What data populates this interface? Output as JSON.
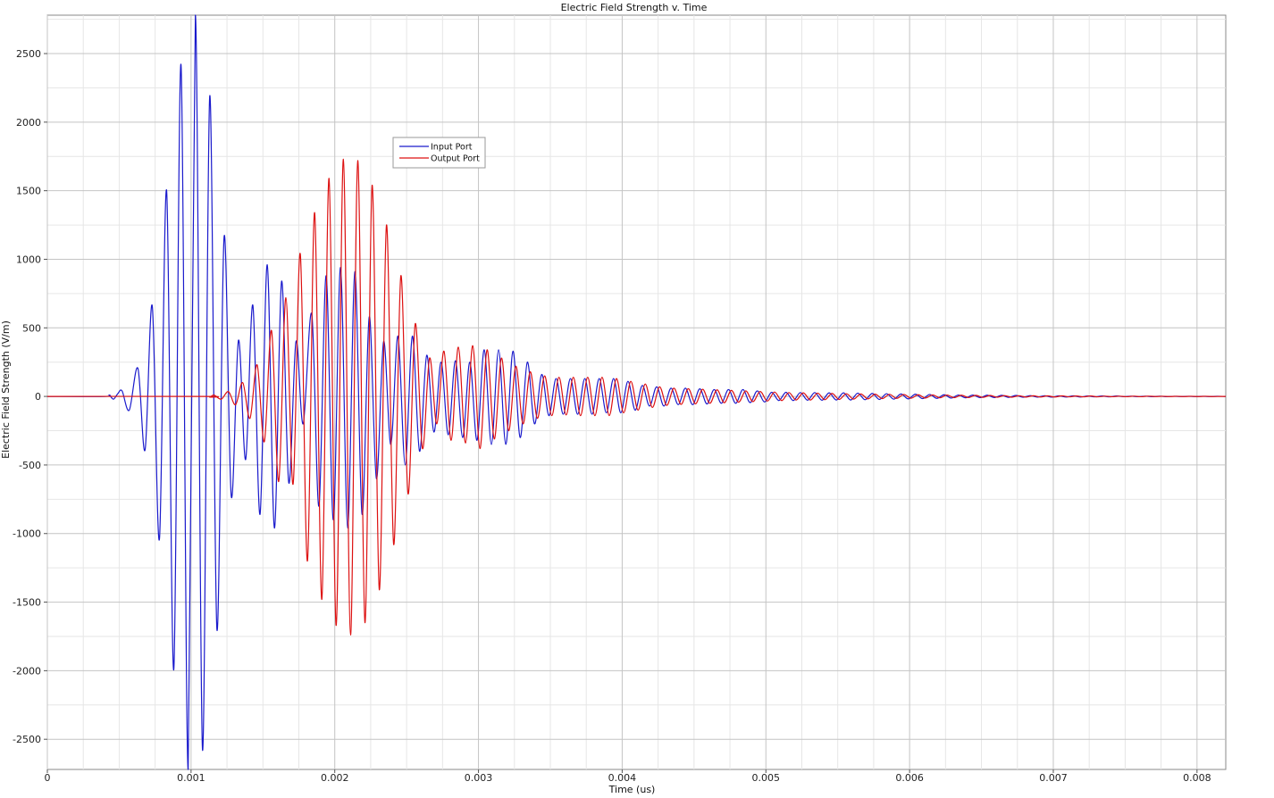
{
  "chart_data": {
    "type": "line",
    "title": "Electric Field Strength v. Time",
    "xlabel": "Time (us)",
    "ylabel": "Electric Field Strength (V/m)",
    "xlim": [
      0,
      0.0082
    ],
    "ylim": [
      -2720,
      2780
    ],
    "x_ticks": [
      "0",
      "0.001",
      "0.002",
      "0.003",
      "0.004",
      "0.005",
      "0.006",
      "0.007",
      "0.008"
    ],
    "y_ticks": [
      "-2500",
      "-2000",
      "-1500",
      "-1000",
      "-500",
      "0",
      "500",
      "1000",
      "1500",
      "2000",
      "2500"
    ],
    "grid": true,
    "legend_position": "upper-center",
    "series": [
      {
        "name": "Input Port",
        "color": "#1a1acc",
        "points": [
          [
            0.0004,
            0
          ],
          [
            0.00043,
            10
          ],
          [
            0.00046,
            -20
          ],
          [
            0.00049,
            20
          ],
          [
            0.00052,
            40
          ],
          [
            0.00057,
            -100
          ],
          [
            0.00063,
            205
          ],
          [
            0.00068,
            -390
          ],
          [
            0.00073,
            660
          ],
          [
            0.00078,
            -1040
          ],
          [
            0.00083,
            1500
          ],
          [
            0.00088,
            -1990
          ],
          [
            0.00093,
            2420
          ],
          [
            0.00098,
            -2720
          ],
          [
            0.00103,
            2780
          ],
          [
            0.00108,
            -2580
          ],
          [
            0.00113,
            2190
          ],
          [
            0.00118,
            -1700
          ],
          [
            0.00123,
            1165
          ],
          [
            0.00128,
            -730
          ],
          [
            0.00133,
            410
          ],
          [
            0.00138,
            -460
          ],
          [
            0.00143,
            665
          ],
          [
            0.00148,
            -860
          ],
          [
            0.00153,
            960
          ],
          [
            0.00158,
            -960
          ],
          [
            0.00163,
            840
          ],
          [
            0.00168,
            -630
          ],
          [
            0.00173,
            400
          ],
          [
            0.00178,
            -200
          ],
          [
            0.00184,
            600
          ],
          [
            0.00189,
            -800
          ],
          [
            0.00194,
            880
          ],
          [
            0.00199,
            -900
          ],
          [
            0.00204,
            940
          ],
          [
            0.00209,
            -960
          ],
          [
            0.00214,
            910
          ],
          [
            0.00219,
            -860
          ],
          [
            0.00224,
            580
          ],
          [
            0.00229,
            -600
          ],
          [
            0.00234,
            400
          ],
          [
            0.00239,
            -350
          ],
          [
            0.00244,
            440
          ],
          [
            0.00249,
            -500
          ],
          [
            0.00254,
            440
          ],
          [
            0.00259,
            -400
          ],
          [
            0.00264,
            300
          ],
          [
            0.00269,
            -260
          ],
          [
            0.00274,
            250
          ],
          [
            0.00279,
            -280
          ],
          [
            0.00284,
            260
          ],
          [
            0.00289,
            -300
          ],
          [
            0.00294,
            250
          ],
          [
            0.00299,
            -320
          ],
          [
            0.00304,
            340
          ],
          [
            0.00309,
            -350
          ],
          [
            0.00314,
            340
          ],
          [
            0.00319,
            -350
          ],
          [
            0.00324,
            330
          ],
          [
            0.00329,
            -300
          ],
          [
            0.00334,
            250
          ],
          [
            0.00339,
            -200
          ],
          [
            0.00344,
            160
          ],
          [
            0.00349,
            -140
          ],
          [
            0.00354,
            130
          ],
          [
            0.00359,
            -130
          ],
          [
            0.00364,
            130
          ],
          [
            0.00369,
            -130
          ],
          [
            0.00374,
            130
          ],
          [
            0.00379,
            -130
          ],
          [
            0.00384,
            130
          ],
          [
            0.00389,
            -120
          ],
          [
            0.00394,
            130
          ],
          [
            0.00399,
            -120
          ],
          [
            0.00404,
            110
          ],
          [
            0.00409,
            -100
          ],
          [
            0.00414,
            80
          ],
          [
            0.00419,
            -70
          ],
          [
            0.00424,
            70
          ],
          [
            0.00429,
            -70
          ],
          [
            0.00434,
            60
          ],
          [
            0.00439,
            -60
          ],
          [
            0.00444,
            60
          ],
          [
            0.00449,
            -60
          ],
          [
            0.00454,
            55
          ],
          [
            0.00459,
            -55
          ],
          [
            0.00464,
            50
          ],
          [
            0.00469,
            -50
          ],
          [
            0.00474,
            50
          ],
          [
            0.00479,
            -50
          ],
          [
            0.00484,
            50
          ],
          [
            0.00489,
            -45
          ],
          [
            0.00494,
            40
          ],
          [
            0.00499,
            -40
          ],
          [
            0.00504,
            30
          ],
          [
            0.00509,
            -30
          ],
          [
            0.00514,
            30
          ],
          [
            0.00519,
            -30
          ],
          [
            0.00524,
            28
          ],
          [
            0.00529,
            -28
          ],
          [
            0.00534,
            28
          ],
          [
            0.00539,
            -28
          ],
          [
            0.00544,
            26
          ],
          [
            0.00549,
            -26
          ],
          [
            0.00554,
            26
          ],
          [
            0.00559,
            -26
          ],
          [
            0.00564,
            24
          ],
          [
            0.00569,
            -24
          ],
          [
            0.00574,
            22
          ],
          [
            0.00579,
            -22
          ],
          [
            0.00584,
            20
          ],
          [
            0.00589,
            -20
          ],
          [
            0.00594,
            18
          ],
          [
            0.00599,
            -18
          ],
          [
            0.00604,
            16
          ],
          [
            0.00609,
            -16
          ],
          [
            0.00614,
            14
          ],
          [
            0.00619,
            -14
          ],
          [
            0.00624,
            12
          ],
          [
            0.00629,
            -12
          ],
          [
            0.00634,
            10
          ],
          [
            0.00639,
            -10
          ],
          [
            0.00644,
            10
          ],
          [
            0.00649,
            -9
          ],
          [
            0.00654,
            9
          ],
          [
            0.00659,
            -8
          ],
          [
            0.00664,
            8
          ],
          [
            0.00669,
            -7
          ],
          [
            0.00674,
            7
          ],
          [
            0.00679,
            -6
          ],
          [
            0.00684,
            6
          ],
          [
            0.00689,
            -5
          ],
          [
            0.00694,
            5
          ],
          [
            0.00699,
            -5
          ],
          [
            0.00704,
            4
          ],
          [
            0.00709,
            -4
          ],
          [
            0.00714,
            4
          ],
          [
            0.00719,
            -4
          ],
          [
            0.00724,
            3
          ],
          [
            0.00729,
            -3
          ],
          [
            0.00734,
            3
          ],
          [
            0.00739,
            -3
          ],
          [
            0.00744,
            3
          ],
          [
            0.00749,
            -2
          ],
          [
            0.00754,
            2
          ],
          [
            0.00759,
            -2
          ],
          [
            0.00764,
            2
          ],
          [
            0.00769,
            -2
          ],
          [
            0.00774,
            2
          ],
          [
            0.00779,
            -2
          ],
          [
            0.00784,
            1
          ],
          [
            0.00789,
            -1
          ],
          [
            0.00794,
            1
          ],
          [
            0.00799,
            -1
          ],
          [
            0.00804,
            1
          ],
          [
            0.00809,
            -1
          ],
          [
            0.00814,
            1
          ],
          [
            0.00819,
            0
          ]
        ]
      },
      {
        "name": "Output Port",
        "color": "#dd1111",
        "points": [
          [
            0.0,
            0
          ],
          [
            0.0011,
            0
          ],
          [
            0.00113,
            -5
          ],
          [
            0.00116,
            10
          ],
          [
            0.00121,
            -20
          ],
          [
            0.00126,
            35
          ],
          [
            0.00131,
            -60
          ],
          [
            0.00136,
            100
          ],
          [
            0.00141,
            -160
          ],
          [
            0.00146,
            230
          ],
          [
            0.00151,
            -330
          ],
          [
            0.00156,
            480
          ],
          [
            0.00161,
            -620
          ],
          [
            0.00166,
            720
          ],
          [
            0.00171,
            -640
          ],
          [
            0.00176,
            1040
          ],
          [
            0.00181,
            -1200
          ],
          [
            0.00186,
            1340
          ],
          [
            0.00191,
            -1480
          ],
          [
            0.00196,
            1590
          ],
          [
            0.00201,
            -1670
          ],
          [
            0.00206,
            1730
          ],
          [
            0.00211,
            -1740
          ],
          [
            0.00216,
            1720
          ],
          [
            0.00221,
            -1650
          ],
          [
            0.00226,
            1540
          ],
          [
            0.00231,
            -1410
          ],
          [
            0.00236,
            1250
          ],
          [
            0.00241,
            -1080
          ],
          [
            0.00246,
            880
          ],
          [
            0.00251,
            -710
          ],
          [
            0.00256,
            530
          ],
          [
            0.00261,
            -380
          ],
          [
            0.00266,
            280
          ],
          [
            0.00271,
            -200
          ],
          [
            0.00276,
            330
          ],
          [
            0.00281,
            -320
          ],
          [
            0.00286,
            360
          ],
          [
            0.00291,
            -340
          ],
          [
            0.00296,
            370
          ],
          [
            0.00301,
            -380
          ],
          [
            0.00306,
            340
          ],
          [
            0.00311,
            -310
          ],
          [
            0.00316,
            280
          ],
          [
            0.00321,
            -250
          ],
          [
            0.00326,
            220
          ],
          [
            0.00331,
            -200
          ],
          [
            0.00336,
            180
          ],
          [
            0.00341,
            -160
          ],
          [
            0.00346,
            150
          ],
          [
            0.00351,
            -140
          ],
          [
            0.00356,
            140
          ],
          [
            0.00361,
            -135
          ],
          [
            0.00366,
            140
          ],
          [
            0.00371,
            -140
          ],
          [
            0.00376,
            140
          ],
          [
            0.00381,
            -140
          ],
          [
            0.00386,
            140
          ],
          [
            0.00391,
            -140
          ],
          [
            0.00396,
            130
          ],
          [
            0.00401,
            -120
          ],
          [
            0.00406,
            110
          ],
          [
            0.00411,
            -100
          ],
          [
            0.00416,
            90
          ],
          [
            0.00421,
            -80
          ],
          [
            0.00426,
            70
          ],
          [
            0.00431,
            -65
          ],
          [
            0.00436,
            60
          ],
          [
            0.00441,
            -58
          ],
          [
            0.00446,
            56
          ],
          [
            0.00451,
            -54
          ],
          [
            0.00456,
            52
          ],
          [
            0.00461,
            -50
          ],
          [
            0.00466,
            48
          ],
          [
            0.00471,
            -46
          ],
          [
            0.00476,
            44
          ],
          [
            0.00481,
            -42
          ],
          [
            0.00486,
            40
          ],
          [
            0.00491,
            -38
          ],
          [
            0.00496,
            36
          ],
          [
            0.00501,
            -34
          ],
          [
            0.00506,
            32
          ],
          [
            0.00511,
            -30
          ],
          [
            0.00516,
            28
          ],
          [
            0.00521,
            -26
          ],
          [
            0.00526,
            26
          ],
          [
            0.00531,
            -26
          ],
          [
            0.00536,
            24
          ],
          [
            0.00541,
            -24
          ],
          [
            0.00546,
            22
          ],
          [
            0.00551,
            -22
          ],
          [
            0.00556,
            20
          ],
          [
            0.00561,
            -20
          ],
          [
            0.00566,
            18
          ],
          [
            0.00571,
            -18
          ],
          [
            0.00576,
            16
          ],
          [
            0.00581,
            -16
          ],
          [
            0.00586,
            15
          ],
          [
            0.00591,
            -14
          ],
          [
            0.00596,
            14
          ],
          [
            0.00601,
            -13
          ],
          [
            0.00606,
            12
          ],
          [
            0.00611,
            -12
          ],
          [
            0.00616,
            11
          ],
          [
            0.00621,
            -10
          ],
          [
            0.00626,
            10
          ],
          [
            0.00631,
            -9
          ],
          [
            0.00636,
            9
          ],
          [
            0.00641,
            -8
          ],
          [
            0.00646,
            8
          ],
          [
            0.00651,
            -7
          ],
          [
            0.00656,
            7
          ],
          [
            0.00661,
            -6
          ],
          [
            0.00666,
            6
          ],
          [
            0.00671,
            -6
          ],
          [
            0.00676,
            5
          ],
          [
            0.00681,
            -5
          ],
          [
            0.00686,
            5
          ],
          [
            0.00691,
            -4
          ],
          [
            0.00696,
            4
          ],
          [
            0.00701,
            -4
          ],
          [
            0.00706,
            4
          ],
          [
            0.00711,
            -3
          ],
          [
            0.00716,
            3
          ],
          [
            0.00721,
            -3
          ],
          [
            0.00726,
            3
          ],
          [
            0.00731,
            -3
          ],
          [
            0.00736,
            2
          ],
          [
            0.00741,
            -2
          ],
          [
            0.00746,
            2
          ],
          [
            0.00751,
            -2
          ],
          [
            0.00756,
            2
          ],
          [
            0.00761,
            -2
          ],
          [
            0.00766,
            2
          ],
          [
            0.00771,
            -1
          ],
          [
            0.00776,
            1
          ],
          [
            0.00781,
            -1
          ],
          [
            0.00786,
            1
          ],
          [
            0.00791,
            -1
          ],
          [
            0.00796,
            1
          ],
          [
            0.00801,
            -1
          ],
          [
            0.00806,
            1
          ],
          [
            0.00811,
            -1
          ],
          [
            0.00816,
            0
          ],
          [
            0.0082,
            0
          ]
        ]
      }
    ]
  }
}
